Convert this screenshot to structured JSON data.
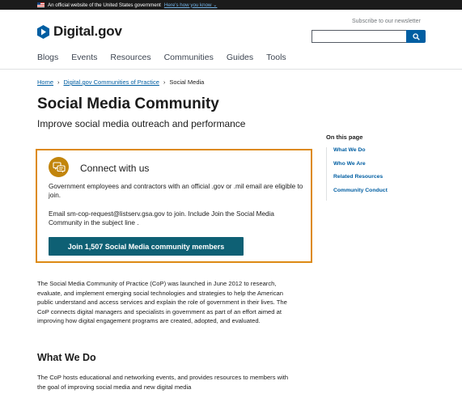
{
  "gov_banner": {
    "text": "An official website of the United States government",
    "link": "Here's how you know ⌄"
  },
  "header": {
    "logo_text": "Digital.gov",
    "newsletter_link": "Subscribe to our newsletter",
    "search_placeholder": ""
  },
  "nav": {
    "items": [
      "Blogs",
      "Events",
      "Resources",
      "Communities",
      "Guides",
      "Tools"
    ]
  },
  "breadcrumb": {
    "items": [
      "Home",
      "Digital.gov Communities of Practice",
      "Social Media"
    ],
    "separator": "›"
  },
  "page": {
    "title": "Social Media Community",
    "subtitle": "Improve social media outreach and performance"
  },
  "connect": {
    "heading": "Connect with us",
    "eligibility": "Government employees and contractors with an official .gov or .mil email are eligible to join.",
    "instructions": "Email sm-cop-request@listserv.gsa.gov to join. Include Join the Social Media Community in the subject line .",
    "join_label": "Join 1,507 Social Media community members"
  },
  "on_this_page": {
    "title": "On this page",
    "items": [
      "What We Do",
      "Who We Are",
      "Related Resources",
      "Community Conduct"
    ]
  },
  "content": {
    "intro": "The Social Media Community of Practice (CoP) was launched in June 2012 to research, evaluate, and implement emerging social technologies and strategies to help the American public understand and access services and explain the role of government in their lives. The CoP connects digital managers and specialists in government as part of an effort aimed at improving how digital engagement programs are created, adopted, and evaluated.",
    "what_we_do_heading": "What We Do",
    "what_we_do_text": "The CoP hosts educational and networking events, and provides resources to members with the goal of improving social media and new digital media"
  },
  "colors": {
    "brand_blue": "#005ea2",
    "card_border": "#dd8a14",
    "join_button": "#0e6074",
    "banner_bg": "#1b1b1b"
  }
}
